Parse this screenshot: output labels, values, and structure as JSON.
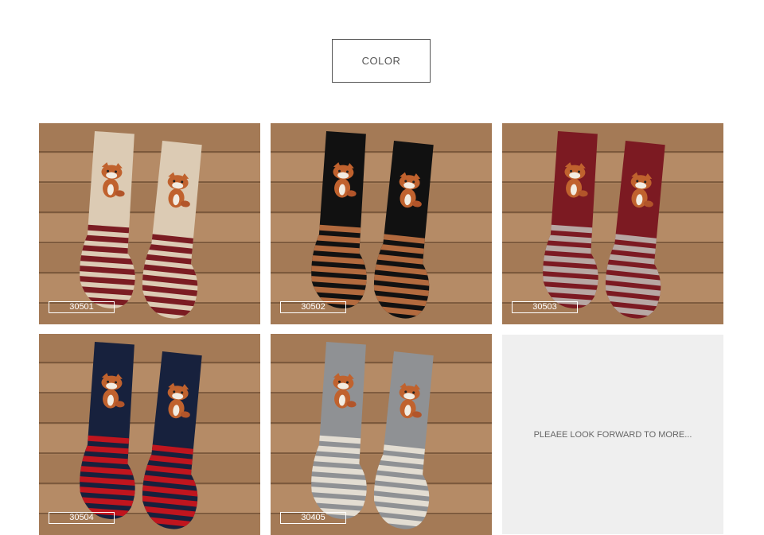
{
  "header": {
    "color_label": "COLOR"
  },
  "products": [
    {
      "code": "30501",
      "body": "#dccbb4",
      "stripe": "#7b1c22",
      "gap": "#dccbb4"
    },
    {
      "code": "30502",
      "body": "#111111",
      "stripe": "#b26a3e",
      "gap": "#111111"
    },
    {
      "code": "30503",
      "body": "#7c1a22",
      "stripe": "#b7a7a3",
      "gap": "#7c1a22"
    },
    {
      "code": "30504",
      "body": "#17213d",
      "stripe": "#c0151e",
      "gap": "#17213d"
    },
    {
      "code": "30405",
      "body": "#8f9194",
      "stripe": "#e3ddd2",
      "gap": "#8f9194"
    }
  ],
  "more_text": "PLEAEE LOOK FORWARD TO MORE..."
}
